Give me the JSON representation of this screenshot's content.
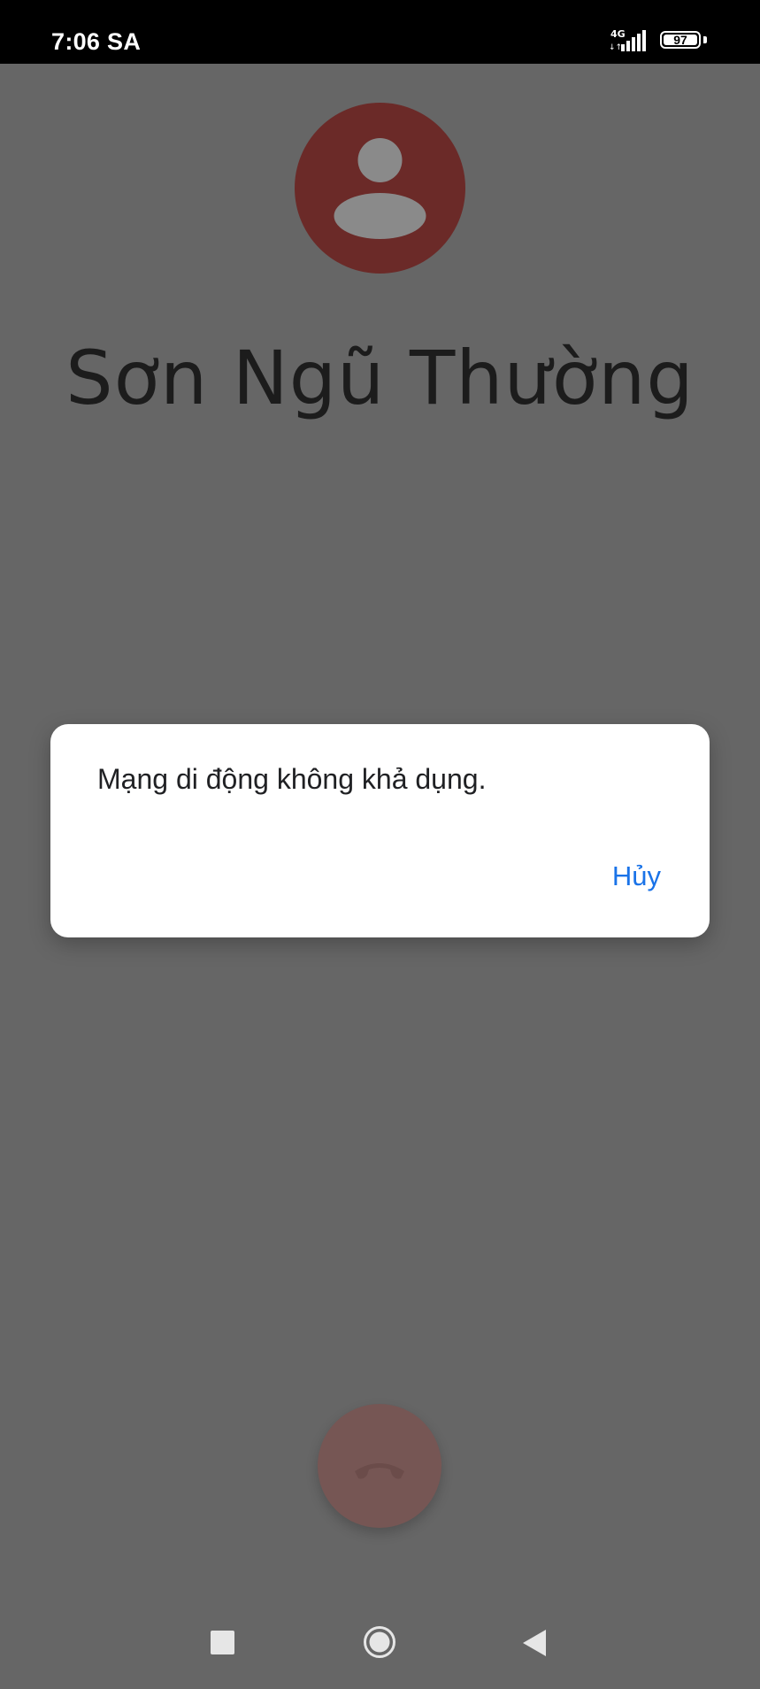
{
  "status_bar": {
    "time": "7:06 SA",
    "network_type": "4G",
    "battery_level": "97",
    "icons": [
      "signal-icon",
      "battery-icon"
    ]
  },
  "call_screen": {
    "avatar_icon": "person-icon",
    "contact_name": "Sơn Ngũ Thường",
    "end_call_icon": "phone-hangup-icon"
  },
  "dialog": {
    "message": "Mạng di động không khả dụng.",
    "cancel_label": "Hủy"
  },
  "navigation_bar": {
    "icons": [
      "recents-icon",
      "home-icon",
      "back-icon"
    ]
  },
  "colors": {
    "scrim": "#666666",
    "status_bar": "#000000",
    "avatar_background": "#6b2a28",
    "avatar_glyph": "#8a8a8a",
    "dialog_background": "#ffffff",
    "accent_blue": "#1a73e8",
    "end_call_button": "#765654"
  }
}
